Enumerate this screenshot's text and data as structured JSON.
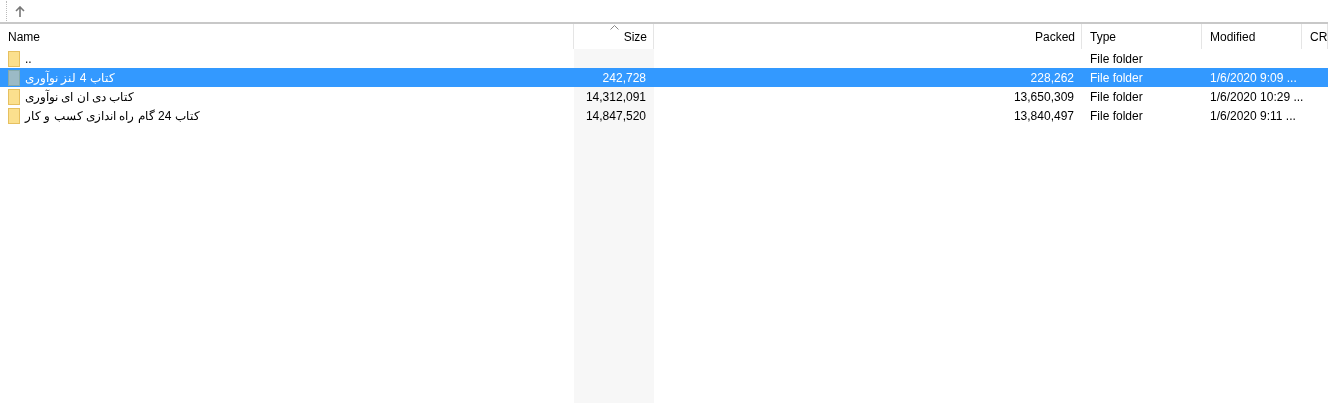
{
  "table": {
    "columns": [
      {
        "label": "Name",
        "sorted": false,
        "kind": "text"
      },
      {
        "label": "Size",
        "sorted": true,
        "kind": "number"
      },
      {
        "label": "Packed",
        "sorted": false,
        "kind": "number"
      },
      {
        "label": "Type",
        "sorted": false,
        "kind": "text"
      },
      {
        "label": "Modified",
        "sorted": false,
        "kind": "text"
      },
      {
        "label": "CR",
        "sorted": false,
        "kind": "text"
      }
    ],
    "rows": [
      {
        "name": "..",
        "size": "",
        "packed": "",
        "type": "File folder",
        "modified": "",
        "selected": false
      },
      {
        "name": "کتاب 4 لنز نوآوری",
        "size": "242,728",
        "packed": "228,262",
        "type": "File folder",
        "modified": "1/6/2020 9:09 ...",
        "selected": true
      },
      {
        "name": "کتاب دی ان ای نوآوری",
        "size": "14,312,091",
        "packed": "13,650,309",
        "type": "File folder",
        "modified": "1/6/2020 10:29 ...",
        "selected": false
      },
      {
        "name": "کتاب 24 گام راه اندازی کسب و کار",
        "size": "14,847,520",
        "packed": "13,840,497",
        "type": "File folder",
        "modified": "1/6/2020 9:11 ...",
        "selected": false
      }
    ]
  }
}
